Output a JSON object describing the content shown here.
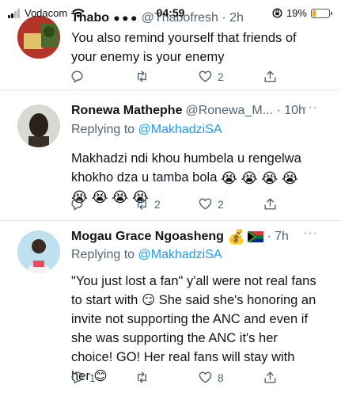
{
  "status_bar": {
    "carrier": "Vodacom",
    "time": "04:59",
    "battery_percent": "19%",
    "battery_level": 0.19
  },
  "tweets": [
    {
      "display_name": "Thabo",
      "handle_meta": "@Thabofresh · 2h",
      "body": "You also remind yourself that friends of your enemy is your enemy",
      "replies": "",
      "retweets": "",
      "likes": "2"
    },
    {
      "display_name": "Ronewa Mathephe",
      "handle_meta": "@Ronewa_M... · 10h",
      "replying_label": "Replying to",
      "replying_to": "@MakhadziSA",
      "body": "Makhadzi ndi khou humbela u rengelwa khokho dza u tamba bola",
      "emoji": "😭",
      "replies": "",
      "retweets": "2",
      "likes": "2"
    },
    {
      "display_name": "Mogau Grace Ngoasheng",
      "handle_meta": "· 7h",
      "replying_label": "Replying to",
      "replying_to": "@MakhadziSA",
      "body": "\"You just lost a fan\" y'all were not real fans to start with 😏 She said she's honoring an invite not supporting the ANC and even if she was supporting the ANC it's her choice! GO! Her real fans will stay with her 😊",
      "replies": "1",
      "retweets": "",
      "likes": "8"
    }
  ],
  "icons": {
    "reply": "reply-icon",
    "retweet": "retweet-icon",
    "like": "heart-icon",
    "share": "share-icon",
    "more": "more-icon"
  },
  "colors": {
    "link": "#1d9bf0",
    "secondary": "#536471",
    "divider": "#e1e6ea"
  }
}
